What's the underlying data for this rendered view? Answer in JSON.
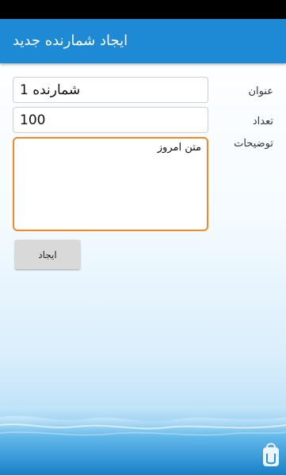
{
  "app_bar": {
    "title": "ایجاد شمارنده جدید"
  },
  "form": {
    "title_label": "عنوان",
    "title_value": "شمارنده 1",
    "count_label": "تعداد",
    "count_value": "100",
    "description_label": "توضیحات",
    "description_value": "متن امروز",
    "create_button_label": "ایجاد"
  },
  "colors": {
    "app_bar": "#1e8ad6",
    "focus_border": "#f08a24",
    "button": "#d9d9d9"
  },
  "icons": {
    "logo": "cafebazaar-logo-icon"
  }
}
